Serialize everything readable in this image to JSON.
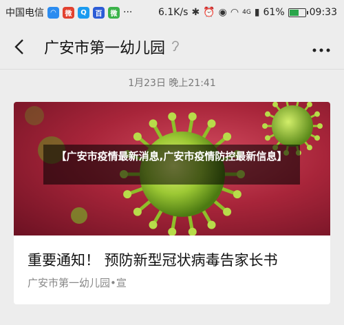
{
  "status_bar": {
    "carrier": "中国电信",
    "dots": "···",
    "speed": "6.1K/s",
    "signal_label": "4G",
    "battery_percent_text": "61%",
    "battery_level": 0.61,
    "time": "09:33",
    "app_icons": [
      "qq-browser-icon",
      "weibo-icon",
      "qq-icon",
      "baidu-icon",
      "wechat-icon"
    ]
  },
  "nav": {
    "title": "广安市第一幼儿园"
  },
  "timestamp": "1月23日 晚上21:41",
  "card": {
    "overlay_caption": "【广安市疫情最新消息,广安市疫情防控最新信息】",
    "headline": "重要通知！ 预防新型冠状病毒告家长书",
    "source": "广安市第一幼儿园•宣"
  },
  "colors": {
    "background": "#ededed",
    "battery_fill": "#2aa54a",
    "virus_green": "#a6d63a"
  }
}
